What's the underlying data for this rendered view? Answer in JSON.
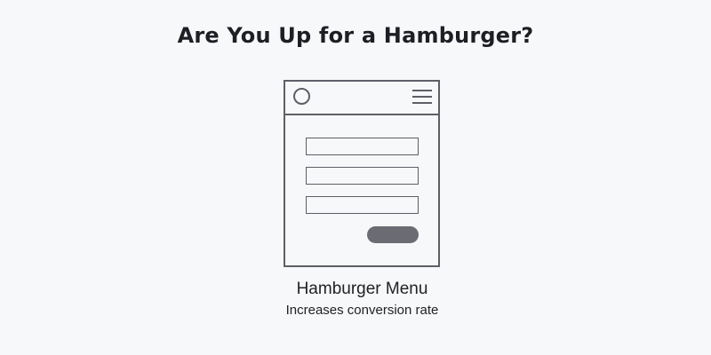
{
  "title": "Are You Up for a Hamburger?",
  "mockup": {
    "header_icons": [
      "circle-icon",
      "hamburger-menu-icon"
    ],
    "field_count": 3,
    "button_color": "#6b6c73",
    "outline_color": "#5e5f66"
  },
  "caption": {
    "title": "Hamburger Menu",
    "subtitle": "Increases conversion rate"
  }
}
